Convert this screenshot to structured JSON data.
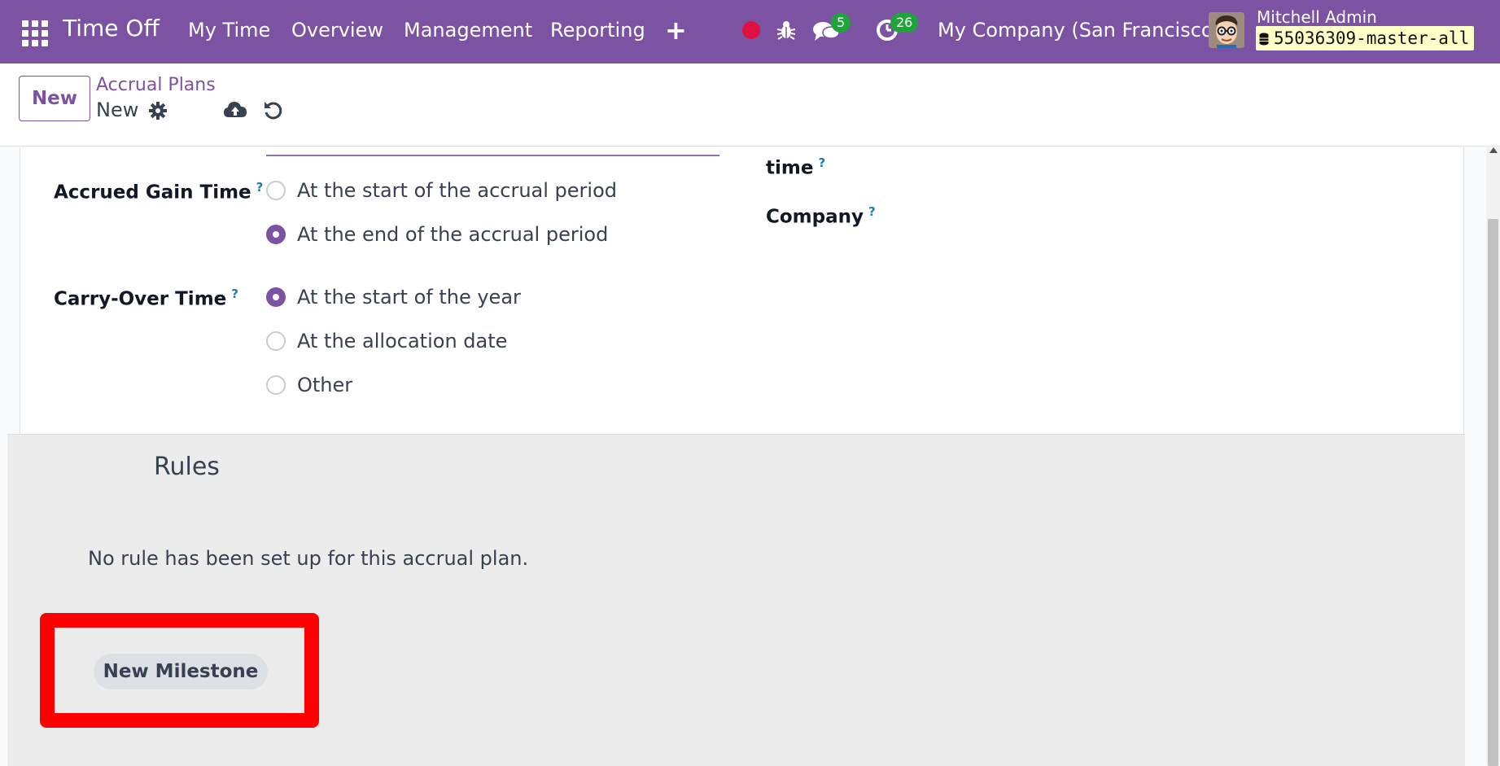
{
  "navbar": {
    "brand": "Time Off",
    "menu": [
      "My Time",
      "Overview",
      "Management",
      "Reporting"
    ],
    "plus": "+",
    "chat_badge": "5",
    "activity_badge": "26",
    "company": "My Company (San Francisco)",
    "user_name": "Mitchell Admin",
    "database": "55036309-master-all"
  },
  "control": {
    "new_button": "New",
    "breadcrumb_parent": "Accrual Plans",
    "breadcrumb_current": "New"
  },
  "form": {
    "right_labels": {
      "time": "time",
      "company": "Company"
    },
    "help_mark": "?",
    "accrued_gain_time": {
      "label": "Accrued Gain Time",
      "options": [
        "At the start of the accrual period",
        "At the end of the accrual period"
      ],
      "selected": 1
    },
    "carry_over_time": {
      "label": "Carry-Over Time",
      "options": [
        "At the start of the year",
        "At the allocation date",
        "Other"
      ],
      "selected": 0
    }
  },
  "rules": {
    "title": "Rules",
    "empty_message": "No rule has been set up for this accrual plan.",
    "new_milestone_button": "New Milestone"
  },
  "colors": {
    "brand": "#7c52a3",
    "badge": "#1fa43a",
    "record": "#e0113e",
    "highlight": "#ff0000"
  }
}
